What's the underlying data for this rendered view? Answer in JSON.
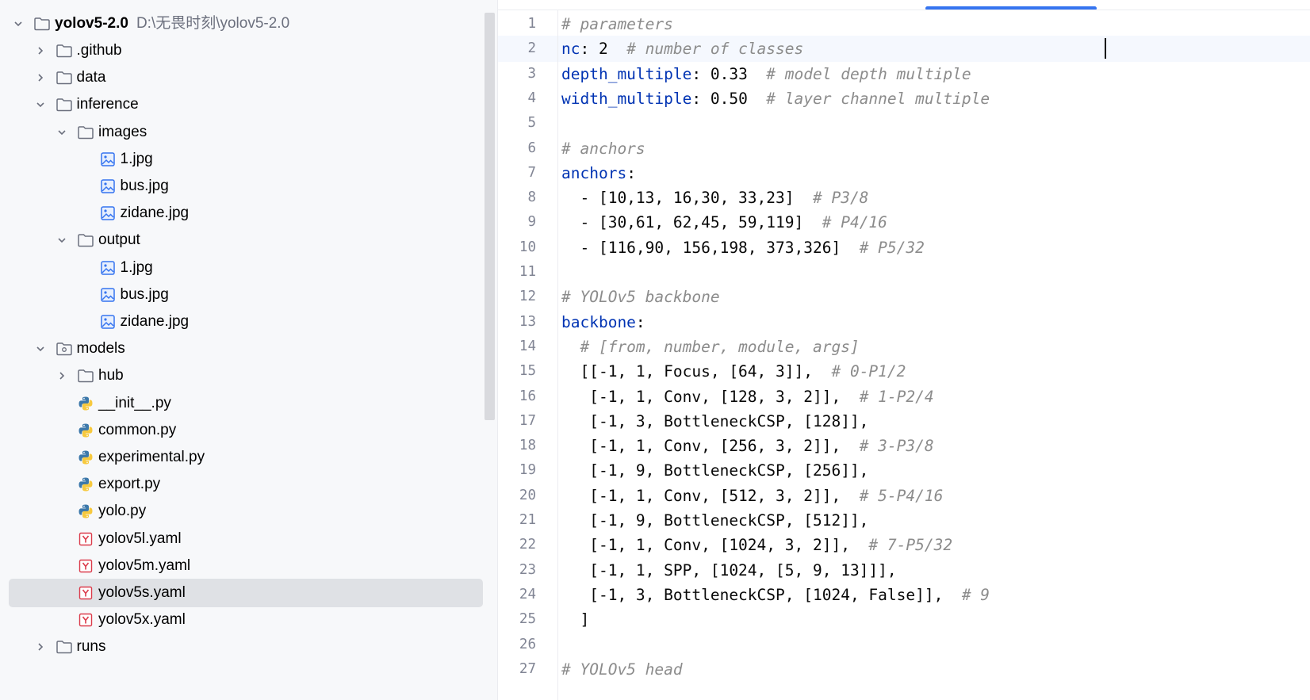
{
  "tree": {
    "root": {
      "name": "yolov5-2.0",
      "path": "D:\\无畏时刻\\yolov5-2.0"
    },
    "items": [
      {
        "label": ".github",
        "kind": "folder",
        "expanded": false
      },
      {
        "label": "data",
        "kind": "folder",
        "expanded": false
      },
      {
        "label": "inference",
        "kind": "folder",
        "expanded": true
      },
      {
        "label": "images",
        "kind": "folder",
        "expanded": true
      },
      {
        "label": "1.jpg",
        "kind": "image"
      },
      {
        "label": "bus.jpg",
        "kind": "image"
      },
      {
        "label": "zidane.jpg",
        "kind": "image"
      },
      {
        "label": "output",
        "kind": "folder",
        "expanded": true
      },
      {
        "label": "1.jpg",
        "kind": "image"
      },
      {
        "label": "bus.jpg",
        "kind": "image"
      },
      {
        "label": "zidane.jpg",
        "kind": "image"
      },
      {
        "label": "models",
        "kind": "package",
        "expanded": true
      },
      {
        "label": "hub",
        "kind": "folder",
        "expanded": false
      },
      {
        "label": "__init__.py",
        "kind": "python"
      },
      {
        "label": "common.py",
        "kind": "python"
      },
      {
        "label": "experimental.py",
        "kind": "python"
      },
      {
        "label": "export.py",
        "kind": "python"
      },
      {
        "label": "yolo.py",
        "kind": "python"
      },
      {
        "label": "yolov5l.yaml",
        "kind": "yaml"
      },
      {
        "label": "yolov5m.yaml",
        "kind": "yaml"
      },
      {
        "label": "yolov5s.yaml",
        "kind": "yaml",
        "selected": true
      },
      {
        "label": "yolov5x.yaml",
        "kind": "yaml"
      },
      {
        "label": "runs",
        "kind": "folder",
        "expanded": false
      }
    ]
  },
  "editor": {
    "current_line": 2,
    "lines": [
      {
        "n": "1",
        "tokens": [
          [
            "c",
            "# parameters"
          ]
        ]
      },
      {
        "n": "2",
        "tokens": [
          [
            "k",
            "nc"
          ],
          [
            "t",
            ": 2  "
          ],
          [
            "c",
            "# number of classes"
          ]
        ]
      },
      {
        "n": "3",
        "tokens": [
          [
            "k",
            "depth_multiple"
          ],
          [
            "t",
            ": 0.33  "
          ],
          [
            "c",
            "# model depth multiple"
          ]
        ]
      },
      {
        "n": "4",
        "tokens": [
          [
            "k",
            "width_multiple"
          ],
          [
            "t",
            ": 0.50  "
          ],
          [
            "c",
            "# layer channel multiple"
          ]
        ]
      },
      {
        "n": "5",
        "tokens": []
      },
      {
        "n": "6",
        "tokens": [
          [
            "c",
            "# anchors"
          ]
        ]
      },
      {
        "n": "7",
        "tokens": [
          [
            "k",
            "anchors"
          ],
          [
            "t",
            ":"
          ]
        ]
      },
      {
        "n": "8",
        "tokens": [
          [
            "t",
            "  - [10,13, 16,30, 33,23]  "
          ],
          [
            "c",
            "# P3/8"
          ]
        ]
      },
      {
        "n": "9",
        "tokens": [
          [
            "t",
            "  - [30,61, 62,45, 59,119]  "
          ],
          [
            "c",
            "# P4/16"
          ]
        ]
      },
      {
        "n": "10",
        "tokens": [
          [
            "t",
            "  - [116,90, 156,198, 373,326]  "
          ],
          [
            "c",
            "# P5/32"
          ]
        ]
      },
      {
        "n": "11",
        "tokens": []
      },
      {
        "n": "12",
        "tokens": [
          [
            "c",
            "# YOLOv5 backbone"
          ]
        ]
      },
      {
        "n": "13",
        "tokens": [
          [
            "k",
            "backbone"
          ],
          [
            "t",
            ":"
          ]
        ]
      },
      {
        "n": "14",
        "tokens": [
          [
            "t",
            "  "
          ],
          [
            "c",
            "# [from, number, module, args]"
          ]
        ]
      },
      {
        "n": "15",
        "tokens": [
          [
            "t",
            "  [[-1, 1, Focus, [64, 3]],  "
          ],
          [
            "c",
            "# 0-P1/2"
          ]
        ]
      },
      {
        "n": "16",
        "tokens": [
          [
            "t",
            "   [-1, 1, Conv, [128, 3, 2]],  "
          ],
          [
            "c",
            "# 1-P2/4"
          ]
        ]
      },
      {
        "n": "17",
        "tokens": [
          [
            "t",
            "   [-1, 3, BottleneckCSP, [128]],"
          ]
        ]
      },
      {
        "n": "18",
        "tokens": [
          [
            "t",
            "   [-1, 1, Conv, [256, 3, 2]],  "
          ],
          [
            "c",
            "# 3-P3/8"
          ]
        ]
      },
      {
        "n": "19",
        "tokens": [
          [
            "t",
            "   [-1, 9, BottleneckCSP, [256]],"
          ]
        ]
      },
      {
        "n": "20",
        "tokens": [
          [
            "t",
            "   [-1, 1, Conv, [512, 3, 2]],  "
          ],
          [
            "c",
            "# 5-P4/16"
          ]
        ]
      },
      {
        "n": "21",
        "tokens": [
          [
            "t",
            "   [-1, 9, BottleneckCSP, [512]],"
          ]
        ]
      },
      {
        "n": "22",
        "tokens": [
          [
            "t",
            "   [-1, 1, Conv, [1024, 3, 2]],  "
          ],
          [
            "c",
            "# 7-P5/32"
          ]
        ]
      },
      {
        "n": "23",
        "tokens": [
          [
            "t",
            "   [-1, 1, SPP, [1024, [5, 9, 13]]],"
          ]
        ]
      },
      {
        "n": "24",
        "tokens": [
          [
            "t",
            "   [-1, 3, BottleneckCSP, [1024, False]],  "
          ],
          [
            "c",
            "# 9"
          ]
        ]
      },
      {
        "n": "25",
        "tokens": [
          [
            "t",
            "  ]"
          ]
        ]
      },
      {
        "n": "26",
        "tokens": []
      },
      {
        "n": "27",
        "tokens": [
          [
            "c",
            "# YOLOv5 head"
          ]
        ]
      }
    ]
  }
}
